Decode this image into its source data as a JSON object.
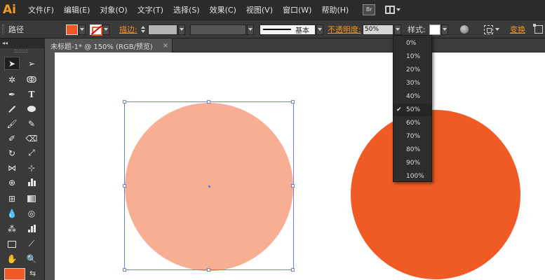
{
  "app": {
    "logo": "Ai"
  },
  "menu": [
    "文件(F)",
    "编辑(E)",
    "对象(O)",
    "文字(T)",
    "选择(S)",
    "效果(C)",
    "视图(V)",
    "窗口(W)",
    "帮助(H)"
  ],
  "bridge_button": "Br",
  "control_bar": {
    "object_type": "路径",
    "stroke_label": "描边:",
    "stroke_profile_label": "基本",
    "opacity_label": "不透明度:",
    "opacity_value": "50%",
    "style_label": "样式:",
    "transform_label": "变换",
    "fill_color": "#f05a24",
    "stroke_color": "none"
  },
  "document_tab": {
    "title": "未标题-1* @ 150% (RGB/预览)",
    "close": "×"
  },
  "toolbox": {
    "collapse_arrows": "◂◂",
    "foreground_color": "#f05a24"
  },
  "canvas": {
    "circle_light_color": "#f7ae92",
    "circle_dark_color": "#f05a24"
  },
  "opacity_dropdown": {
    "options": [
      "0%",
      "10%",
      "20%",
      "30%",
      "40%",
      "50%",
      "60%",
      "70%",
      "80%",
      "90%",
      "100%"
    ],
    "selected": "50%",
    "check": "✔"
  }
}
